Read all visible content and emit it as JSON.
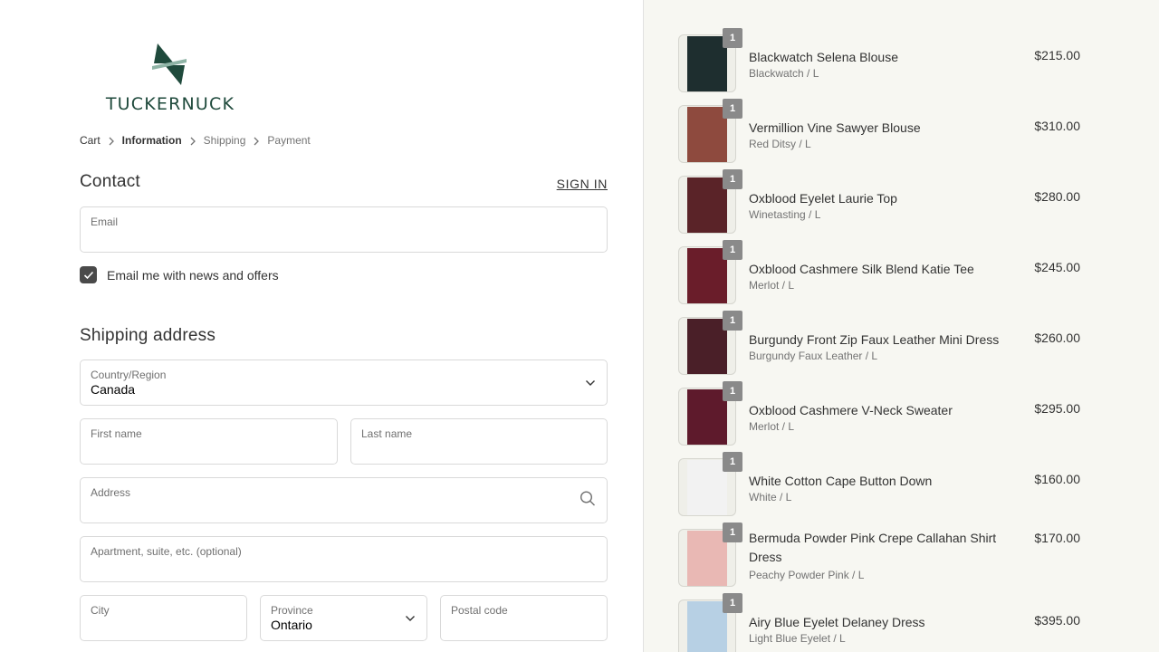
{
  "brand": {
    "name": "TUCKERNUCK",
    "color": "#1f4a3c"
  },
  "breadcrumb": [
    {
      "label": "Cart",
      "state": "link"
    },
    {
      "label": "Information",
      "state": "current"
    },
    {
      "label": "Shipping",
      "state": "muted"
    },
    {
      "label": "Payment",
      "state": "muted"
    }
  ],
  "contact": {
    "title": "Contact",
    "sign_in": "SIGN IN",
    "email_label": "Email",
    "email_value": "",
    "newsletter_label": "Email me with news and offers",
    "newsletter_checked": true
  },
  "shipping": {
    "title": "Shipping address",
    "country_label": "Country/Region",
    "country_value": "Canada",
    "first_name_label": "First name",
    "last_name_label": "Last name",
    "address_label": "Address",
    "apartment_label": "Apartment, suite, etc. (optional)",
    "city_label": "City",
    "province_label": "Province",
    "province_value": "Ontario",
    "postal_label": "Postal code"
  },
  "order_items": [
    {
      "name": "Blackwatch Selena Blouse",
      "variant": "Blackwatch / L",
      "price": "$215.00",
      "qty": "1",
      "swatch": "#1e2e2f"
    },
    {
      "name": "Vermillion Vine Sawyer Blouse",
      "variant": "Red Ditsy / L",
      "price": "$310.00",
      "qty": "1",
      "swatch": "#8e4a3e"
    },
    {
      "name": "Oxblood Eyelet Laurie Top",
      "variant": "Winetasting / L",
      "price": "$280.00",
      "qty": "1",
      "swatch": "#5a2328"
    },
    {
      "name": "Oxblood Cashmere Silk Blend Katie Tee",
      "variant": "Merlot / L",
      "price": "$245.00",
      "qty": "1",
      "swatch": "#6a1d2a"
    },
    {
      "name": "Burgundy Front Zip Faux Leather Mini Dress",
      "variant": "Burgundy Faux Leather / L",
      "price": "$260.00",
      "qty": "1",
      "swatch": "#4a1f28"
    },
    {
      "name": "Oxblood Cashmere V-Neck Sweater",
      "variant": "Merlot / L",
      "price": "$295.00",
      "qty": "1",
      "swatch": "#5e1a2c"
    },
    {
      "name": "White Cotton Cape Button Down",
      "variant": "White / L",
      "price": "$160.00",
      "qty": "1",
      "swatch": "#f2f2f2"
    },
    {
      "name": "Bermuda Powder Pink Crepe Callahan Shirt Dress",
      "variant": "Peachy Powder Pink / L",
      "price": "$170.00",
      "qty": "1",
      "swatch": "#e9b8b4"
    },
    {
      "name": "Airy Blue Eyelet Delaney Dress",
      "variant": "Light Blue Eyelet / L",
      "price": "$395.00",
      "qty": "1",
      "swatch": "#b7d0e4"
    }
  ]
}
